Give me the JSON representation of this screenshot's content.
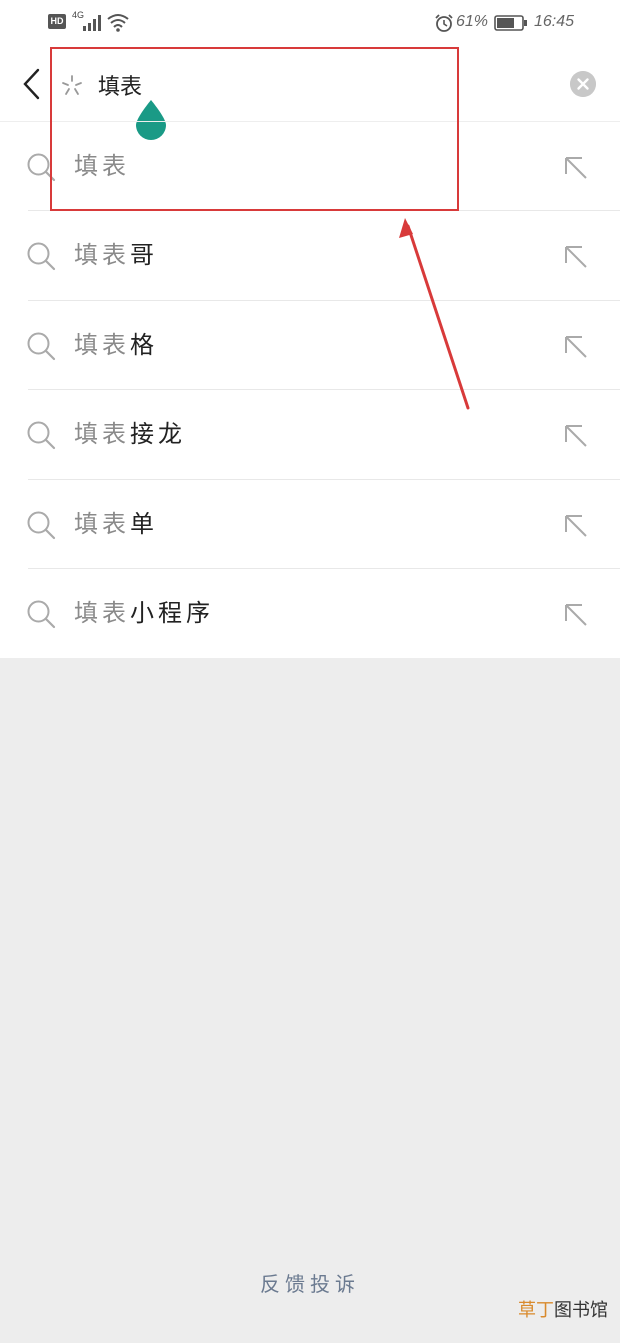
{
  "status_bar": {
    "hd": "HD",
    "network": "4G",
    "battery_percent": "61%",
    "time": "16:45"
  },
  "search": {
    "query": "填表",
    "icons": {
      "back": "back-arrow-icon",
      "loading": "loading-spinner-icon",
      "clear": "clear-circle-icon"
    }
  },
  "suggestions": [
    {
      "query": "填表",
      "rest": ""
    },
    {
      "query": "填表",
      "rest": "哥"
    },
    {
      "query": "填表",
      "rest": "格"
    },
    {
      "query": "填表",
      "rest": "接龙"
    },
    {
      "query": "填表",
      "rest": "单"
    },
    {
      "query": "填表",
      "rest": "小程序"
    }
  ],
  "footer": {
    "feedback": "反馈投诉"
  },
  "watermark": {
    "part1": "草丁",
    "part2": "图书馆"
  },
  "colors": {
    "annotation_red": "#d83a3a",
    "cursor_teal": "#1a9a86",
    "background": "#ededed"
  }
}
